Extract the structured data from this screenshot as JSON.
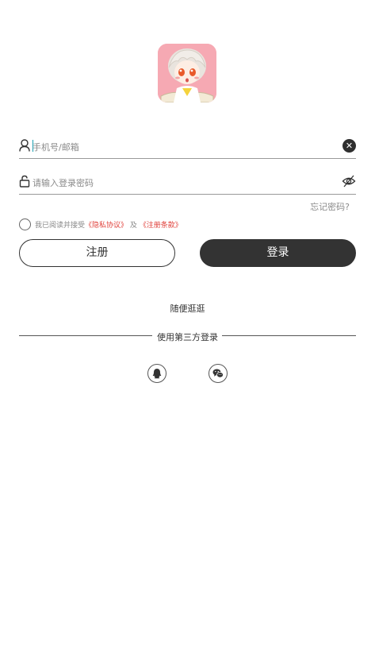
{
  "logo": {
    "icon": "anime-avatar-logo",
    "background": "#f6a9b3"
  },
  "account": {
    "placeholder": "手机号/邮箱",
    "value": "",
    "icon": "user-icon",
    "clear_icon": "clear-icon"
  },
  "password": {
    "placeholder": "请输入登录密码",
    "value": "",
    "icon": "lock-icon",
    "toggle_icon": "eye-off-icon"
  },
  "forgot_label": "忘记密码?",
  "agreement": {
    "prefix": "我已阅读并接受",
    "privacy_link": "《隐私协议》",
    "and": "及",
    "terms_link": "《注册条款》",
    "link_color": "#e0423c"
  },
  "buttons": {
    "register": "注册",
    "login": "登录"
  },
  "browse_label": "随便逛逛",
  "third_party": {
    "label": "使用第三方登录",
    "providers": [
      "qq-icon",
      "wechat-icon"
    ]
  }
}
